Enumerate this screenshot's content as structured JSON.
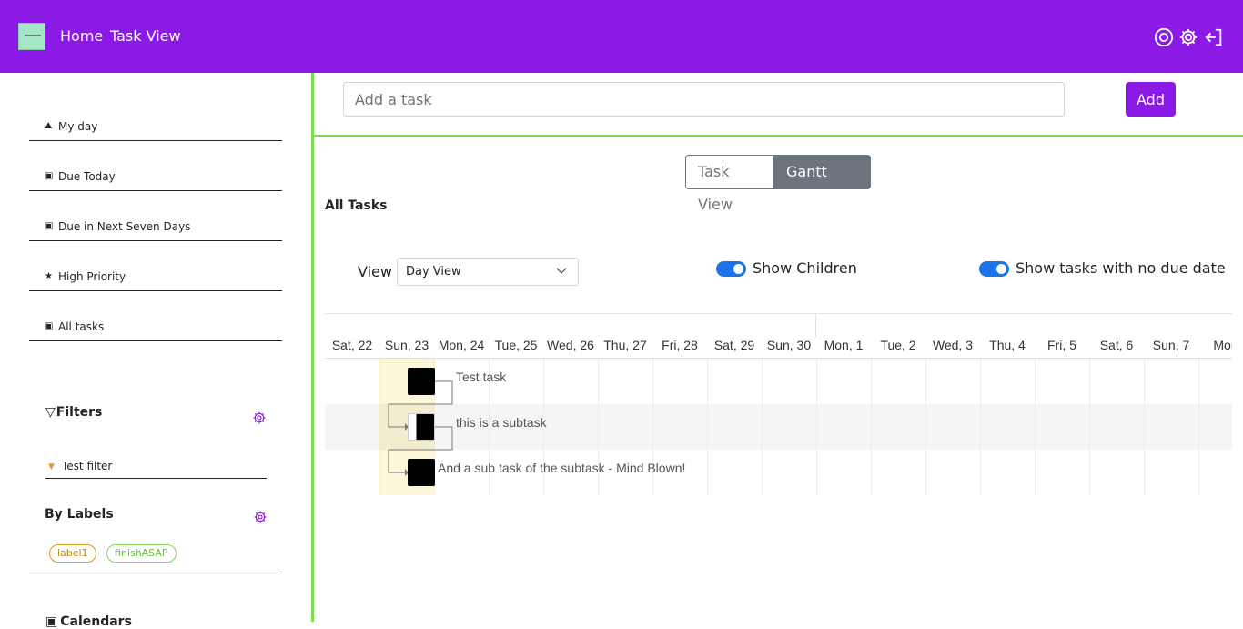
{
  "header": {
    "nav": [
      "Home",
      "Task View"
    ]
  },
  "sidebar": {
    "items": [
      {
        "label": "My day",
        "icon": "sun-icon"
      },
      {
        "label": "Due Today",
        "icon": "calendar-icon"
      },
      {
        "label": "Due in Next Seven Days",
        "icon": "calendar-icon"
      },
      {
        "label": "High Priority",
        "icon": "star-icon"
      },
      {
        "label": "All tasks",
        "icon": "calendar-icon"
      }
    ],
    "filters_title": "Filters",
    "filters": [
      {
        "label": "Test filter",
        "icon": "filter-icon"
      }
    ],
    "labels_title": "By Labels",
    "labels": [
      {
        "label": "label1",
        "color": "#d4a017"
      },
      {
        "label": "finishASAP",
        "color": "#7ed957"
      }
    ],
    "calendars_title": "Calendars"
  },
  "main": {
    "add_placeholder": "Add a task",
    "add_button": "Add",
    "view_toggle": [
      "Task View",
      "Gantt View"
    ],
    "active_view": "Gantt View",
    "section_title": "All Tasks",
    "view_label": "View",
    "view_select": "Day View",
    "show_children_label": "Show Children",
    "show_children": true,
    "show_no_due_label": "Show tasks with no due date",
    "show_no_due": true
  },
  "gantt": {
    "days": [
      "Sat, 22",
      "Sun, 23",
      "Mon, 24",
      "Tue, 25",
      "Wed, 26",
      "Thu, 27",
      "Fri, 28",
      "Sat, 29",
      "Sun, 30",
      "Mon, 1",
      "Tue, 2",
      "Wed, 3",
      "Thu, 4",
      "Fri, 5",
      "Sat, 6",
      "Sun, 7",
      "Mon"
    ],
    "today": "Sun, 23",
    "tasks": [
      {
        "name": "Test task"
      },
      {
        "name": "this is a subtask"
      },
      {
        "name": "And a sub task of the subtask - Mind Blown!"
      }
    ]
  },
  "colors": {
    "brand": "#8b1ae6",
    "accent_green": "#7ed957",
    "toggle_blue": "#1a73e8"
  }
}
